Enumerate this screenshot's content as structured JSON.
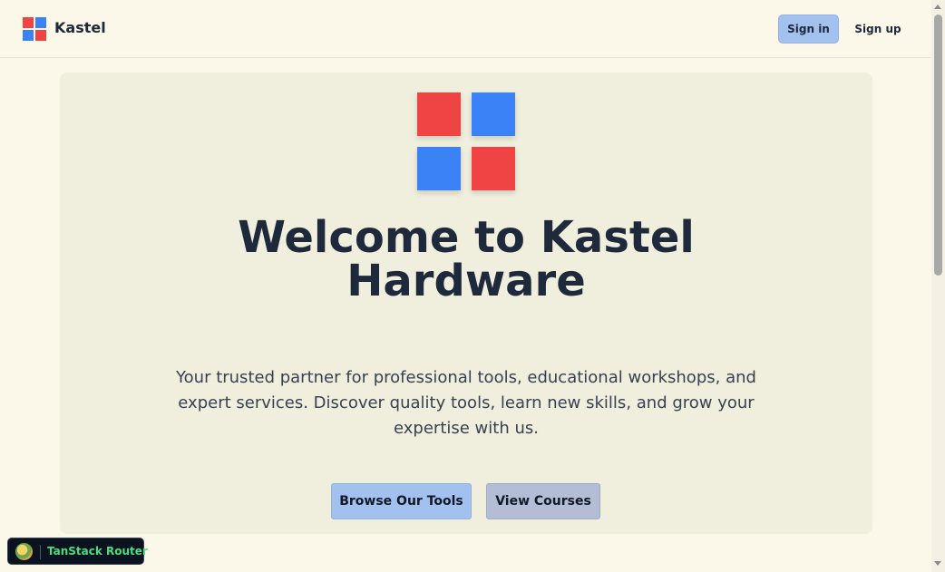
{
  "header": {
    "brand": "Kastel",
    "sign_in_label": "Sign in",
    "sign_up_label": "Sign up"
  },
  "logo_icon": "kastel-grid-logo",
  "colors": {
    "red": "#ef4444",
    "blue": "#3b82f6",
    "background": "#fbf8ea",
    "hero_background": "#f0eedd",
    "primary_button": "#a3c1ef",
    "secondary_button": "#b3bdd6",
    "devtools_label": "#4ade80"
  },
  "hero": {
    "title_line1": "Welcome to Kastel",
    "title_line2": "Hardware",
    "description": "Your trusted partner for professional tools, educational workshops, and expert services. Discover quality tools, learn new skills, and grow your expertise with us.",
    "browse_label": "Browse Our Tools",
    "courses_label": "View Courses"
  },
  "devtools": {
    "label": "TanStack Router",
    "icon": "tanstack-logo-icon"
  }
}
